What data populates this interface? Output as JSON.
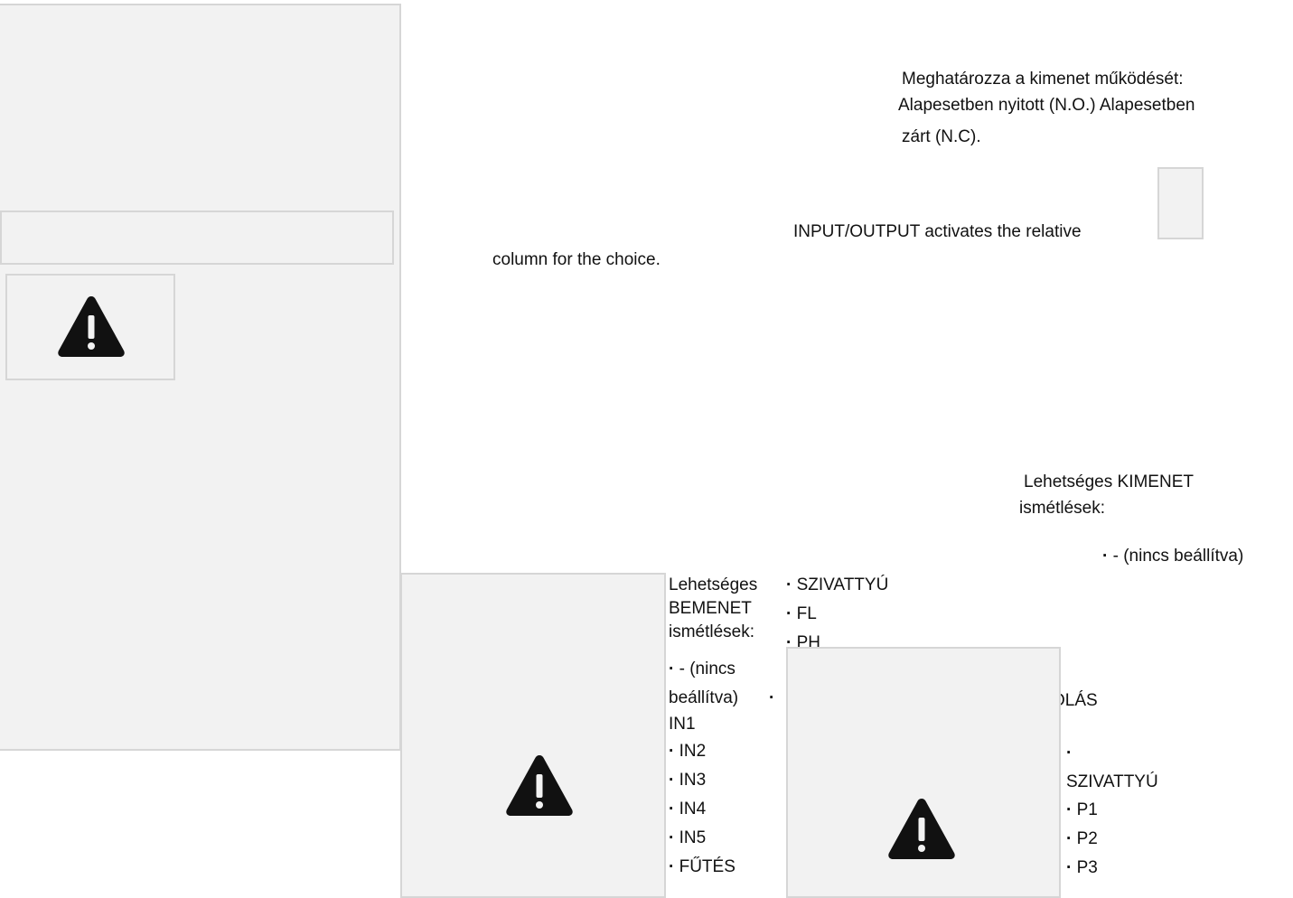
{
  "main_panel": {
    "warning_icon": "warning-triangle-icon"
  },
  "output_mode": {
    "description_line1": "Meghatározza a kimenet működését:",
    "description_line2": "Alapesetben nyitott (N.O.) Alapesetben",
    "description_line3": "zárt (N.C)."
  },
  "io_note": {
    "line1": "INPUT/OUTPUT activates the relative",
    "line2": "column for the choice."
  },
  "output_repeats": {
    "title_line1": "Lehetséges KIMENET",
    "title_line2": "ismétlések:",
    "first_option": "- (nincs beállítva)"
  },
  "input_repeats": {
    "title_line1": "Lehetséges",
    "title_line2": "BEMENET",
    "title_line3": "ismétlések:",
    "unset_line1": "- (nincs",
    "unset_line2": "beállítva)",
    "in1": "IN1",
    "options": [
      "IN2",
      "IN3",
      "IN4",
      "IN5",
      "FŰTÉS"
    ]
  },
  "mid_list": {
    "options": [
      "SZIVATTYÚ",
      "FL",
      "PH"
    ]
  },
  "right_list": {
    "partial_label": "OLÁS",
    "pump_label": "SZIVATTYÚ",
    "options": [
      "P1",
      "P2",
      "P3"
    ]
  },
  "colors": {
    "panel_bg": "#f2f2f2",
    "panel_border": "#d6d6d6",
    "text": "#111111",
    "icon": "#111111"
  }
}
